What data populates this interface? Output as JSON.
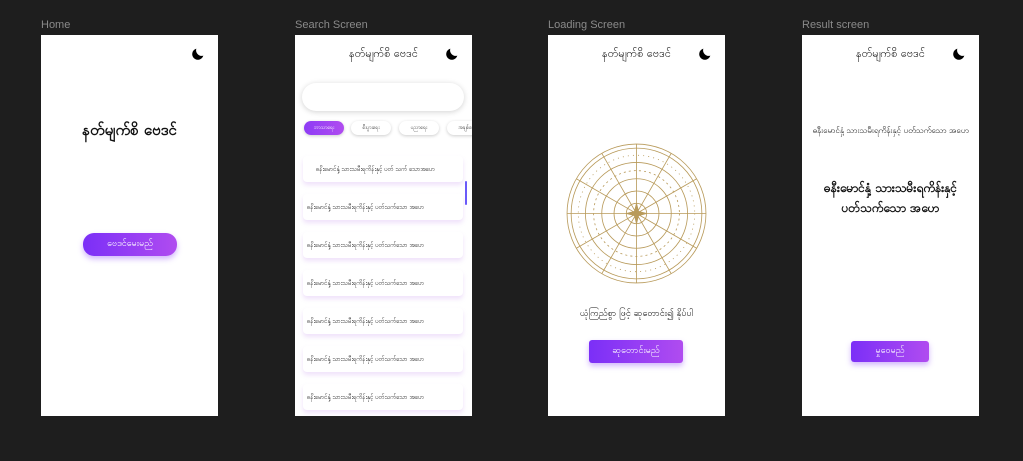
{
  "frames": {
    "home": {
      "label": "Home",
      "title": "နတ်မျက်စိ ဗေဒင်",
      "button_label": "ဗေဒင်မေးမည်"
    },
    "search": {
      "label": "Search Screen",
      "title": "နတ်မျက်စိ ဗေဒင်",
      "search_value": "",
      "chips": [
        {
          "label": "ဘာသာရေး",
          "active": true
        },
        {
          "label": "စီးပွားရေး",
          "active": false
        },
        {
          "label": "ပညာရေး",
          "active": false
        },
        {
          "label": "အချစ်ရေး",
          "active": false
        }
      ],
      "items": [
        "ဓနိးမောင်နှံ့ သားသမီးရကိန်းနှင့်    ပတ် သက် သောအဟေ",
        "ဓနိးမောင်နှံ့ သားသမီးရကိန်းနှင့် ပတ်သက်သော အဟေ",
        "ဓနိးမောင်နှံ့ သားသမီးရကိန်းနှင့် ပတ်သက်သော အဟေ",
        "ဓနိးမောင်နှံ့ သားသမီးရကိန်းနှင့် ပတ်သက်သော အဟေ",
        "ဓနိးမောင်နှံ့ သားသမီးရကိန်းနှင့် ပတ်သက်သော အဟေ",
        "ဓနိးမောင်နှံ့ သားသမီးရကိန်းနှင့် ပတ်သက်သော အဟေ",
        "ဓနိးမောင်နှံ့ သားသမီးရကိန်းနှင့် ပတ်သက်သော အဟေ"
      ]
    },
    "loading": {
      "label": "Loading Screen",
      "title": "နတ်မျက်စိ ဗေဒင်",
      "message": "ယုံကြည်စွာ ဖြင့် ဆုတောင်း၍ နိုပ်ပါ",
      "button_label": "ဆုတောင်းမည်"
    },
    "result": {
      "label": "Result screen",
      "title": "နတ်မျက်စိ ဗေဒင်",
      "question": "ဓနီးမောင်နှံ့ သားသမီးရကိန်းနှင့် ပတ်သက်သော အဟေ",
      "answer": "ဓနီးမောင်နှံ့ သားသမီးရကိန်းနှင့် ပတ်သက်သော အဟေ",
      "button_label": "မှုဝေမည်"
    }
  },
  "colors": {
    "canvas": "#1e1e1e",
    "accent_start": "#7b2ff7",
    "accent_end": "#b04cf0",
    "wheel": "#b89a5a"
  },
  "icons": {
    "theme_toggle": "moon-icon",
    "wheel": "zodiac-wheel-icon"
  }
}
